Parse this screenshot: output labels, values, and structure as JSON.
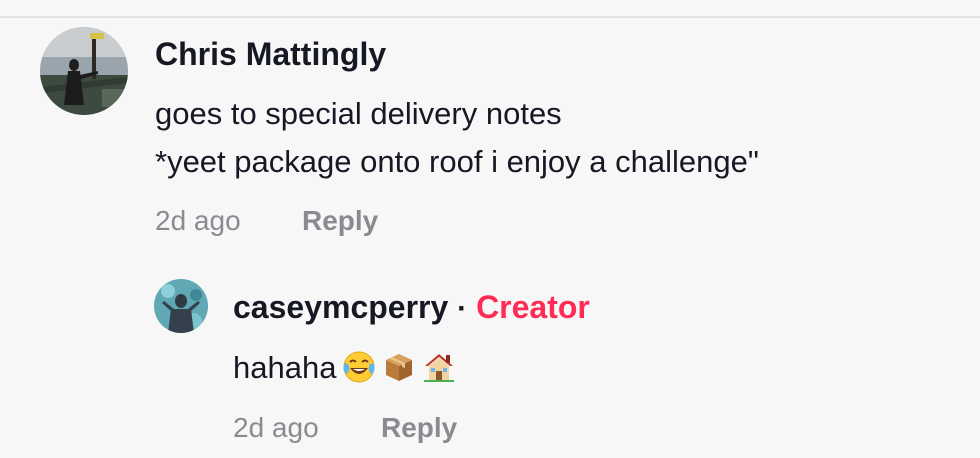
{
  "comment": {
    "author": "Chris Mattingly",
    "lines": [
      "goes to special delivery notes",
      "*yeet package onto roof i enjoy a challenge\""
    ],
    "time": "2d ago",
    "reply_label": "Reply"
  },
  "reply": {
    "author": "caseymcperry",
    "separator": "·",
    "badge": "Creator",
    "text": "hahaha",
    "emojis": [
      "face-with-tears-of-joy-icon",
      "package-icon",
      "house-icon"
    ],
    "time": "2d ago",
    "reply_label": "Reply"
  },
  "colors": {
    "background": "#f7f7f7",
    "text": "#161823",
    "meta": "#8a8b91",
    "creator": "#fe2c55",
    "divider": "#e3e3e3"
  }
}
